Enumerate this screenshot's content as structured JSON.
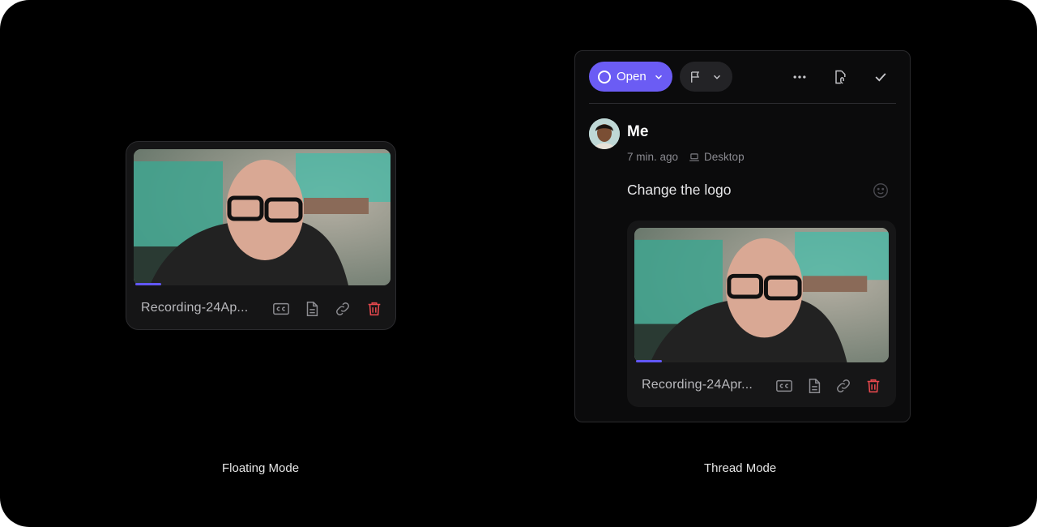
{
  "floating": {
    "caption": "Floating Mode",
    "recording_name": "Recording-24Ap...",
    "icons": [
      "closed-captions-icon",
      "transcript-icon",
      "link-icon",
      "trash-icon"
    ]
  },
  "thread": {
    "caption": "Thread Mode",
    "status_label": "Open",
    "author": "Me",
    "time": "7 min. ago",
    "device": "Desktop",
    "comment": "Change the logo",
    "recording_name": "Recording-24Apr...",
    "icons": [
      "more-icon",
      "attach-file-icon",
      "check-icon",
      "emoji-icon"
    ]
  },
  "colors": {
    "accent": "#6b5cf4",
    "danger": "#e5484d",
    "background": "#000000"
  }
}
